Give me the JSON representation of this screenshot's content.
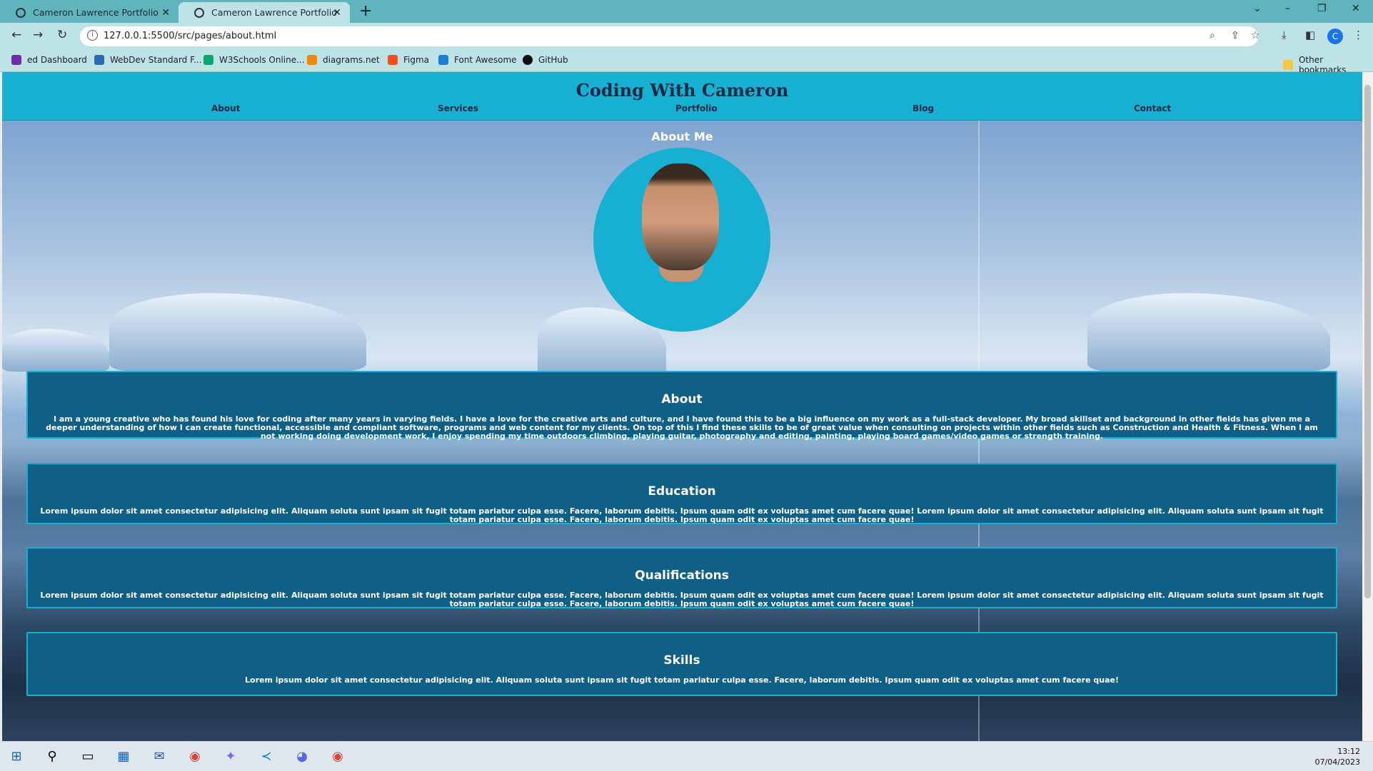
{
  "browser": {
    "tabs": [
      {
        "title": "Cameron Lawrence Portfolio",
        "active": false
      },
      {
        "title": "Cameron Lawrence Portfolio",
        "active": true
      }
    ],
    "url": "127.0.0.1:5500/src/pages/about.html",
    "profile_initial": "C",
    "bookmarks": [
      {
        "label": "ed Dashboard",
        "icon": "ed-icon",
        "color": "#6f2da8"
      },
      {
        "label": "WebDev Standard F...",
        "icon": "webdev-icon",
        "color": "#2b6cb0"
      },
      {
        "label": "W3Schools Online...",
        "icon": "w3schools-icon",
        "color": "#04aa6d"
      },
      {
        "label": "diagrams.net",
        "icon": "diagrams-icon",
        "color": "#f08705"
      },
      {
        "label": "Figma",
        "icon": "figma-icon",
        "color": "#f24e1e"
      },
      {
        "label": "Font Awesome",
        "icon": "fontawesome-icon",
        "color": "#1c7ed6"
      },
      {
        "label": "GitHub",
        "icon": "github-icon",
        "color": "#111111"
      }
    ],
    "other_bookmarks": "Other bookmarks"
  },
  "site": {
    "brand": "Coding With Cameron",
    "nav": [
      "About",
      "Services",
      "Portfolio",
      "Blog",
      "Contact"
    ],
    "page_heading": "About Me",
    "sections": [
      {
        "title": "About",
        "text": "I am a young creative who has found his love for coding after many years in varying fields. I have a love for the creative arts and culture, and I have found this to be a big influence on my work as a full-stack developer. My broad skillset and background in other fields has given me a deeper understanding of how I can create functional, accessible and compliant software, programs and web content for my clients. On top of this I find these skills to be of great value when consulting on projects within other fields such as Construction and Health & Fitness. When I am not working doing development work, I enjoy spending my time outdoors climbing, playing guitar, photography and editing, painting, playing board games/video games or strength training."
      },
      {
        "title": "Education",
        "text": "Lorem ipsum dolor sit amet consectetur adipisicing elit. Aliquam soluta sunt ipsam sit fugit totam pariatur culpa esse. Facere, laborum debitis. Ipsum quam odit ex voluptas amet cum facere quae! Lorem ipsum dolor sit amet consectetur adipisicing elit. Aliquam soluta sunt ipsam sit fugit totam pariatur culpa esse. Facere, laborum debitis. Ipsum quam odit ex voluptas amet cum facere quae!"
      },
      {
        "title": "Qualifications",
        "text": "Lorem ipsum dolor sit amet consectetur adipisicing elit. Aliquam soluta sunt ipsam sit fugit totam pariatur culpa esse. Facere, laborum debitis. Ipsum quam odit ex voluptas amet cum facere quae! Lorem ipsum dolor sit amet consectetur adipisicing elit. Aliquam soluta sunt ipsam sit fugit totam pariatur culpa esse. Facere, laborum debitis. Ipsum quam odit ex voluptas amet cum facere quae!"
      },
      {
        "title": "Skills",
        "text": "Lorem ipsum dolor sit amet consectetur adipisicing elit. Aliquam soluta sunt ipsam sit fugit totam pariatur culpa esse. Facere, laborum debitis. Ipsum quam odit ex voluptas amet cum facere quae!"
      }
    ],
    "colors": {
      "header": "#17b0d2",
      "card": "#0f5f86",
      "brand_text": "#0f2a44"
    }
  },
  "taskbar": {
    "time": "13:12",
    "date": "07/04/2023",
    "apps": [
      "windows-start-icon",
      "search-icon",
      "task-view-icon",
      "store-icon",
      "mail-icon",
      "chrome-icon",
      "copilot-icon",
      "vscode-icon",
      "discord-icon",
      "chrome-icon"
    ]
  }
}
